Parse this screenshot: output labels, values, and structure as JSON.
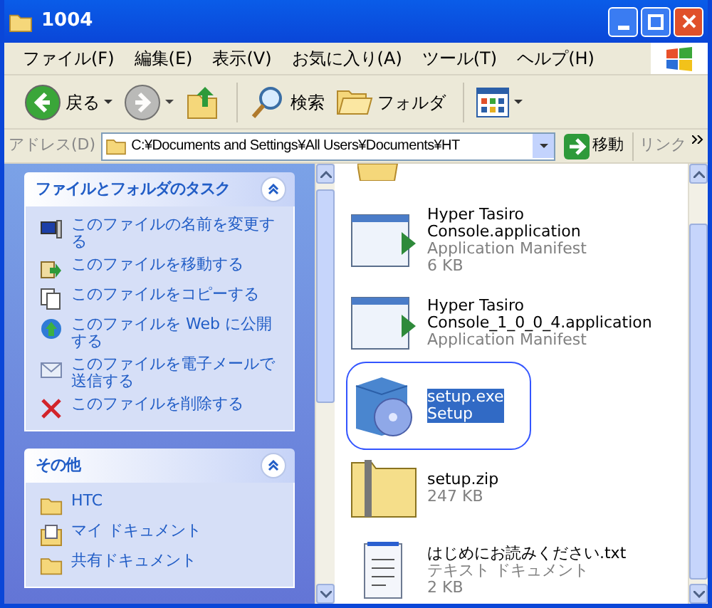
{
  "window": {
    "title": "1004"
  },
  "menu": [
    "ファイル(F)",
    "編集(E)",
    "表示(V)",
    "お気に入り(A)",
    "ツール(T)",
    "ヘルプ(H)"
  ],
  "toolbar": [
    {
      "kind": "back",
      "label": "戻る",
      "disabled": false
    },
    {
      "kind": "forward",
      "disabled": true
    },
    {
      "kind": "up",
      "disabled": false
    },
    {
      "kind": "search",
      "label": "検索",
      "disabled": false
    },
    {
      "kind": "folders",
      "label": "フォルダ",
      "disabled": false
    },
    {
      "kind": "views",
      "disabled": false
    }
  ],
  "address_bar": {
    "label": "アドレス(D)",
    "value": "C:¥Documents and Settings¥All Users¥Documents¥HT",
    "go": "移動",
    "links": "リンク"
  },
  "sidebar": [
    {
      "title": "ファイルとフォルダのタスク",
      "expanded": true,
      "items": [
        {
          "kind": "rename",
          "label": "このファイルの名前を変更する"
        },
        {
          "kind": "move",
          "label": "このファイルを移動する"
        },
        {
          "kind": "copy",
          "label": "このファイルをコピーする"
        },
        {
          "kind": "web",
          "label": "このファイルを Web に公開する"
        },
        {
          "kind": "mail",
          "label": "このファイルを電子メールで送信する"
        },
        {
          "kind": "delete",
          "label": "このファイルを削除する"
        }
      ]
    },
    {
      "title": "その他",
      "expanded": true,
      "items": [
        {
          "kind": "folder",
          "label": "HTC"
        },
        {
          "kind": "documents",
          "label": "マイ ドキュメント"
        },
        {
          "kind": "folder",
          "label": "共有ドキュメント"
        }
      ]
    }
  ],
  "files": [
    {
      "kind": "manifest",
      "name": "Hyper Tasiro Console.application",
      "type": "Application Manifest",
      "size": "6 KB",
      "selected": false
    },
    {
      "kind": "manifest",
      "name": "Hyper Tasiro Console_1_0_0_4.application",
      "type": "Application Manifest",
      "selected": false
    },
    {
      "kind": "setup",
      "name": "setup.exe",
      "type": "Setup",
      "selected": true
    },
    {
      "kind": "zip",
      "name": "setup.zip",
      "size": "247 KB",
      "selected": false
    },
    {
      "kind": "text",
      "name": "はじめにお読みください.txt",
      "type": "テキスト ドキュメント",
      "size": "2 KB",
      "selected": false
    }
  ]
}
